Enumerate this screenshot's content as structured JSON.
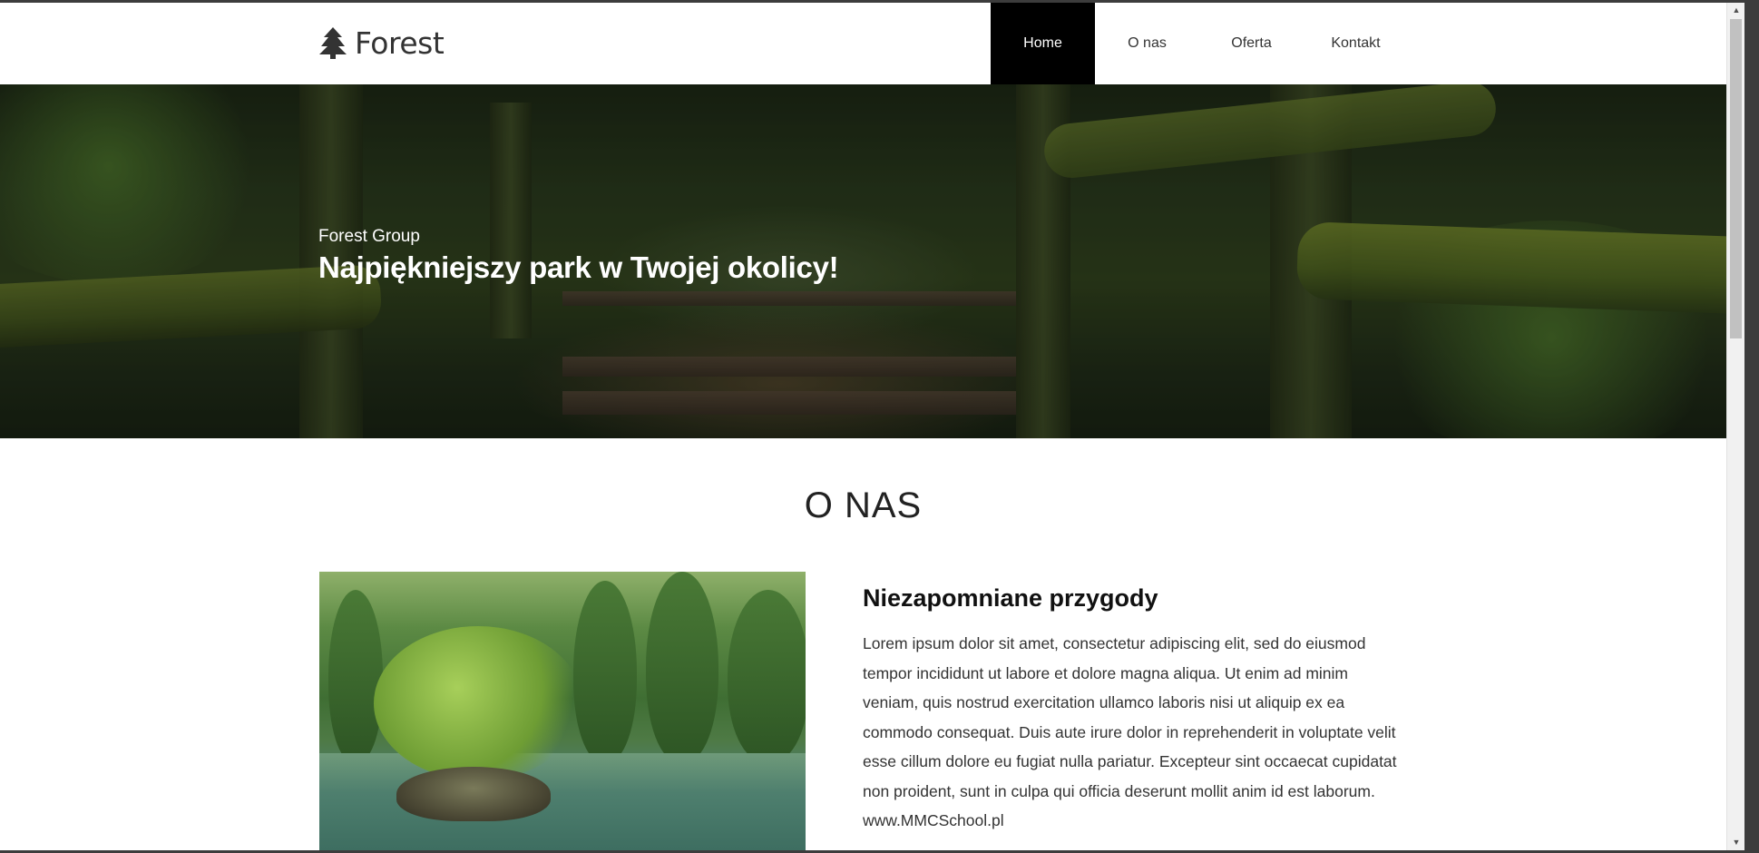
{
  "brand": {
    "name": "Forest",
    "icon": "tree-icon"
  },
  "nav": {
    "items": [
      {
        "label": "Home",
        "active": true
      },
      {
        "label": "O nas",
        "active": false
      },
      {
        "label": "Oferta",
        "active": false
      },
      {
        "label": "Kontakt",
        "active": false
      }
    ]
  },
  "hero": {
    "subtitle": "Forest Group",
    "title": "Najpiękniejszy park w Twojej okolicy!"
  },
  "about": {
    "section_title": "O NAS",
    "heading": "Niezapomniane przygody",
    "body": "Lorem ipsum dolor sit amet, consectetur adipiscing elit, sed do eiusmod tempor incididunt ut labore et dolore magna aliqua. Ut enim ad minim veniam, quis nostrud exercitation ullamco laboris nisi ut aliquip ex ea commodo consequat. Duis aute irure dolor in reprehenderit in voluptate velit esse cillum dolore eu fugiat nulla pariatur. Excepteur sint occaecat cupidatat non proident, sunt in culpa qui officia deserunt mollit anim id est laborum. www.MMCSchool.pl"
  },
  "colors": {
    "nav_active_bg": "#000000",
    "text_dark": "#333333",
    "background": "#ffffff"
  }
}
